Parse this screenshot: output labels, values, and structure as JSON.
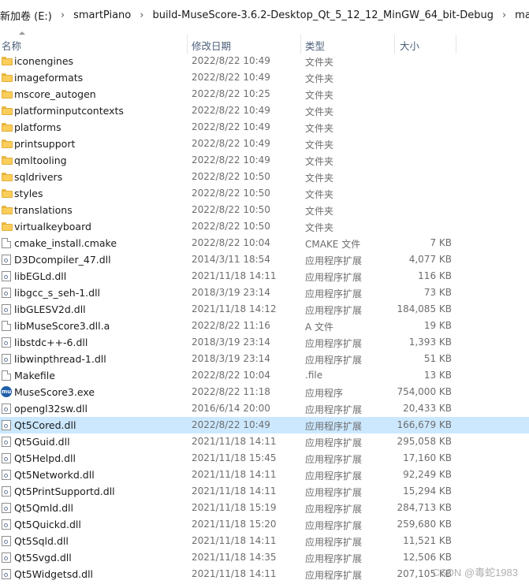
{
  "breadcrumb": {
    "items": [
      "新加卷 (E:)",
      "smartPiano",
      "build-MuseScore-3.6.2-Desktop_Qt_5_12_12_MinGW_64_bit-Debug",
      "main"
    ],
    "separator": "›"
  },
  "columns": {
    "name": "名称",
    "date": "修改日期",
    "type": "类型",
    "size": "大小"
  },
  "files": [
    {
      "name": "iconengines",
      "date": "2022/8/22 10:49",
      "type": "文件夹",
      "size": "",
      "icon": "folder-icon"
    },
    {
      "name": "imageformats",
      "date": "2022/8/22 10:49",
      "type": "文件夹",
      "size": "",
      "icon": "folder-icon"
    },
    {
      "name": "mscore_autogen",
      "date": "2022/8/22 10:25",
      "type": "文件夹",
      "size": "",
      "icon": "folder-icon"
    },
    {
      "name": "platforminputcontexts",
      "date": "2022/8/22 10:49",
      "type": "文件夹",
      "size": "",
      "icon": "folder-icon"
    },
    {
      "name": "platforms",
      "date": "2022/8/22 10:49",
      "type": "文件夹",
      "size": "",
      "icon": "folder-icon"
    },
    {
      "name": "printsupport",
      "date": "2022/8/22 10:49",
      "type": "文件夹",
      "size": "",
      "icon": "folder-icon"
    },
    {
      "name": "qmltooling",
      "date": "2022/8/22 10:49",
      "type": "文件夹",
      "size": "",
      "icon": "folder-icon"
    },
    {
      "name": "sqldrivers",
      "date": "2022/8/22 10:50",
      "type": "文件夹",
      "size": "",
      "icon": "folder-icon"
    },
    {
      "name": "styles",
      "date": "2022/8/22 10:50",
      "type": "文件夹",
      "size": "",
      "icon": "folder-icon"
    },
    {
      "name": "translations",
      "date": "2022/8/22 10:50",
      "type": "文件夹",
      "size": "",
      "icon": "folder-icon"
    },
    {
      "name": "virtualkeyboard",
      "date": "2022/8/22 10:50",
      "type": "文件夹",
      "size": "",
      "icon": "folder-icon"
    },
    {
      "name": "cmake_install.cmake",
      "date": "2022/8/22 10:04",
      "type": "CMAKE 文件",
      "size": "7 KB",
      "icon": "file-icon"
    },
    {
      "name": "D3Dcompiler_47.dll",
      "date": "2014/3/11 18:54",
      "type": "应用程序扩展",
      "size": "4,077 KB",
      "icon": "dll-icon"
    },
    {
      "name": "libEGLd.dll",
      "date": "2021/11/18 14:11",
      "type": "应用程序扩展",
      "size": "116 KB",
      "icon": "dll-icon"
    },
    {
      "name": "libgcc_s_seh-1.dll",
      "date": "2018/3/19 23:14",
      "type": "应用程序扩展",
      "size": "73 KB",
      "icon": "dll-icon"
    },
    {
      "name": "libGLESV2d.dll",
      "date": "2021/11/18 14:12",
      "type": "应用程序扩展",
      "size": "184,085 KB",
      "icon": "dll-icon"
    },
    {
      "name": "libMuseScore3.dll.a",
      "date": "2022/8/22 11:16",
      "type": "A 文件",
      "size": "19 KB",
      "icon": "file-icon"
    },
    {
      "name": "libstdc++-6.dll",
      "date": "2018/3/19 23:14",
      "type": "应用程序扩展",
      "size": "1,393 KB",
      "icon": "dll-icon"
    },
    {
      "name": "libwinpthread-1.dll",
      "date": "2018/3/19 23:14",
      "type": "应用程序扩展",
      "size": "51 KB",
      "icon": "dll-icon"
    },
    {
      "name": "Makefile",
      "date": "2022/8/22 10:04",
      "type": ".file",
      "size": "13 KB",
      "icon": "file-icon"
    },
    {
      "name": "MuseScore3.exe",
      "date": "2022/8/22 11:18",
      "type": "应用程序",
      "size": "754,000 KB",
      "icon": "musescore-app-icon"
    },
    {
      "name": "opengl32sw.dll",
      "date": "2016/6/14 20:00",
      "type": "应用程序扩展",
      "size": "20,433 KB",
      "icon": "dll-icon"
    },
    {
      "name": "Qt5Cored.dll",
      "date": "2022/8/22 10:49",
      "type": "应用程序扩展",
      "size": "166,679 KB",
      "icon": "dll-icon",
      "selected": true
    },
    {
      "name": "Qt5Guid.dll",
      "date": "2021/11/18 14:11",
      "type": "应用程序扩展",
      "size": "295,058 KB",
      "icon": "dll-icon"
    },
    {
      "name": "Qt5Helpd.dll",
      "date": "2021/11/18 15:45",
      "type": "应用程序扩展",
      "size": "17,160 KB",
      "icon": "dll-icon"
    },
    {
      "name": "Qt5Networkd.dll",
      "date": "2021/11/18 14:11",
      "type": "应用程序扩展",
      "size": "92,249 KB",
      "icon": "dll-icon"
    },
    {
      "name": "Qt5PrintSupportd.dll",
      "date": "2021/11/18 14:11",
      "type": "应用程序扩展",
      "size": "15,294 KB",
      "icon": "dll-icon"
    },
    {
      "name": "Qt5Qmld.dll",
      "date": "2021/11/18 15:19",
      "type": "应用程序扩展",
      "size": "284,713 KB",
      "icon": "dll-icon"
    },
    {
      "name": "Qt5Quickd.dll",
      "date": "2021/11/18 15:20",
      "type": "应用程序扩展",
      "size": "259,680 KB",
      "icon": "dll-icon"
    },
    {
      "name": "Qt5Sqld.dll",
      "date": "2021/11/18 14:11",
      "type": "应用程序扩展",
      "size": "11,521 KB",
      "icon": "dll-icon"
    },
    {
      "name": "Qt5Svgd.dll",
      "date": "2021/11/18 14:35",
      "type": "应用程序扩展",
      "size": "12,506 KB",
      "icon": "dll-icon"
    },
    {
      "name": "Qt5Widgetsd.dll",
      "date": "2021/11/18 14:11",
      "type": "应用程序扩展",
      "size": "207,105 KB",
      "icon": "dll-icon"
    }
  ],
  "watermark": "CSDN @毒蛇1983",
  "colors": {
    "selection": "#cce8ff",
    "folder": "#fbcd59",
    "header_text": "#4c607a"
  }
}
